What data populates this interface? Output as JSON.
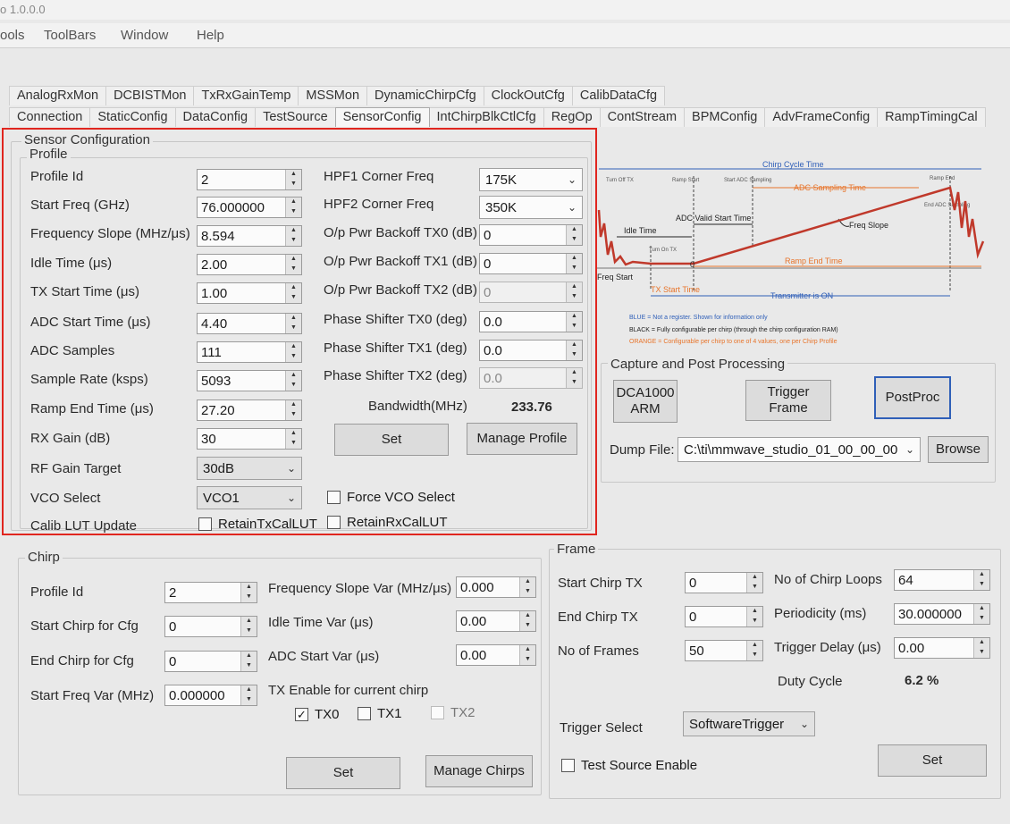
{
  "window": {
    "title_fragment": "o 1.0.0.0"
  },
  "menu": {
    "items": [
      "ools",
      "ToolBars",
      "Window",
      "Help"
    ]
  },
  "tabs_row1": [
    "AnalogRxMon",
    "DCBISTMon",
    "TxRxGainTemp",
    "MSSMon",
    "DynamicChirpCfg",
    "ClockOutCfg",
    "CalibDataCfg"
  ],
  "tabs_row2": [
    "Connection",
    "StaticConfig",
    "DataConfig",
    "TestSource",
    "SensorConfig",
    "IntChirpBlkCtlCfg",
    "RegOp",
    "ContStream",
    "BPMConfig",
    "AdvFrameConfig",
    "RampTimingCal"
  ],
  "sensor": {
    "title": "Sensor Configuration",
    "profile_title": "Profile",
    "labels": {
      "profile_id": "Profile Id",
      "start_freq": "Start Freq (GHz)",
      "freq_slope": "Frequency Slope (MHz/μs)",
      "idle_time": "Idle Time (μs)",
      "tx_start_time": "TX Start Time (μs)",
      "adc_start_time": "ADC Start Time (μs)",
      "adc_samples": "ADC Samples",
      "sample_rate": "Sample Rate (ksps)",
      "ramp_end_time": "Ramp End Time (μs)",
      "rx_gain": "RX Gain (dB)",
      "rf_gain_target": "RF Gain Target",
      "vco_select": "VCO Select",
      "calib_lut_update": "Calib LUT Update",
      "hpf1": "HPF1 Corner Freq",
      "hpf2": "HPF2 Corner Freq",
      "backoff_tx0": "O/p Pwr Backoff TX0 (dB)",
      "backoff_tx1": "O/p Pwr Backoff TX1 (dB)",
      "backoff_tx2": "O/p Pwr Backoff TX2 (dB)",
      "phase_tx0": "Phase Shifter TX0 (deg)",
      "phase_tx1": "Phase Shifter TX1 (deg)",
      "phase_tx2": "Phase Shifter TX2 (deg)",
      "bandwidth": "Bandwidth(MHz)"
    },
    "values": {
      "profile_id": "2",
      "start_freq": "76.000000",
      "freq_slope": "8.594",
      "idle_time": "2.00",
      "tx_start_time": "1.00",
      "adc_start_time": "4.40",
      "adc_samples": "111",
      "sample_rate": "5093",
      "ramp_end_time": "27.20",
      "rx_gain": "30",
      "rf_gain_target": "30dB",
      "vco_select": "VCO1",
      "hpf1": "175K",
      "hpf2": "350K",
      "backoff_tx0": "0",
      "backoff_tx1": "0",
      "backoff_tx2": "0",
      "phase_tx0": "0.0",
      "phase_tx1": "0.0",
      "phase_tx2": "0.0",
      "bandwidth": "233.76"
    },
    "checkboxes": {
      "force_vco": {
        "label": "Force VCO Select",
        "checked": false
      },
      "retain_tx": {
        "label": "RetainTxCalLUT",
        "checked": false
      },
      "retain_rx": {
        "label": "RetainRxCalLUT",
        "checked": false
      }
    },
    "buttons": {
      "set": "Set",
      "manage_profile": "Manage Profile"
    }
  },
  "diagram": {
    "chirp_cycle_time": "Chirp Cycle Time",
    "turn_off_tx": "Turn Off TX",
    "ramp_start": "Ramp Start",
    "start_adc_sampling": "Start ADC Sampling",
    "ramp_end": "Ramp End",
    "adc_sampling_time": "ADC Sampling Time",
    "end_adc_sampling": "End ADC Sampling",
    "adc_valid_start_time": "ADC Valid Start Time",
    "idle_time": "Idle Time",
    "freq_slope": "Freq Slope",
    "turn_on_tx": "Turn On TX",
    "freq_start": "Freq Start",
    "zero": "0",
    "ramp_end_time": "Ramp End Time",
    "tx_start_time": "TX Start Time",
    "transmitter_on": "Transmitter is ON",
    "legend_blue": "BLUE = Not a register. Shown for information only",
    "legend_black": "BLACK = Fully configurable per chirp (through the chirp configuration RAM)",
    "legend_orange": "ORANGE = Configurable per chirp to one of 4 values, one per Chirp Profile",
    "colors": {
      "blue": "#2f5fb8",
      "orange": "#e8742a",
      "red": "#c0392b",
      "black": "#222222"
    }
  },
  "capture": {
    "title": "Capture and Post Processing",
    "dca_button": "DCA1000\nARM",
    "trigger_button": "Trigger\nFrame",
    "postproc_button": "PostProc",
    "dump_label": "Dump File:",
    "dump_value": "C:\\ti\\mmwave_studio_01_00_00_00",
    "browse_button": "Browse"
  },
  "chirp": {
    "title": "Chirp",
    "labels": {
      "profile_id": "Profile Id",
      "start_chirp": "Start Chirp for Cfg",
      "end_chirp": "End Chirp for Cfg",
      "start_freq_var": "Start Freq Var (MHz)",
      "freq_slope_var": "Frequency Slope Var (MHz/μs)",
      "idle_time_var": "Idle Time Var (μs)",
      "adc_start_var": "ADC Start Var (μs)",
      "tx_enable": "TX Enable for current chirp"
    },
    "values": {
      "profile_id": "2",
      "start_chirp": "0",
      "end_chirp": "0",
      "start_freq_var": "0.000000",
      "freq_slope_var": "0.000",
      "idle_time_var": "0.00",
      "adc_start_var": "0.00"
    },
    "tx": [
      {
        "label": "TX0",
        "checked": true,
        "enabled": true
      },
      {
        "label": "TX1",
        "checked": false,
        "enabled": true
      },
      {
        "label": "TX2",
        "checked": false,
        "enabled": false
      }
    ],
    "buttons": {
      "set": "Set",
      "manage_chirps": "Manage Chirps"
    }
  },
  "frame": {
    "title": "Frame",
    "labels": {
      "start_chirp_tx": "Start Chirp TX",
      "end_chirp_tx": "End Chirp TX",
      "no_of_frames": "No of Frames",
      "no_of_chirp_loops": "No of Chirp Loops",
      "periodicity": "Periodicity (ms)",
      "trigger_delay": "Trigger Delay (μs)",
      "duty_cycle": "Duty Cycle",
      "trigger_select": "Trigger Select",
      "test_source": "Test Source Enable"
    },
    "values": {
      "start_chirp_tx": "0",
      "end_chirp_tx": "0",
      "no_of_frames": "50",
      "no_of_chirp_loops": "64",
      "periodicity": "30.000000",
      "trigger_delay": "0.00",
      "duty_cycle": "6.2 %",
      "trigger_select": "SoftwareTrigger"
    },
    "buttons": {
      "set": "Set"
    }
  }
}
